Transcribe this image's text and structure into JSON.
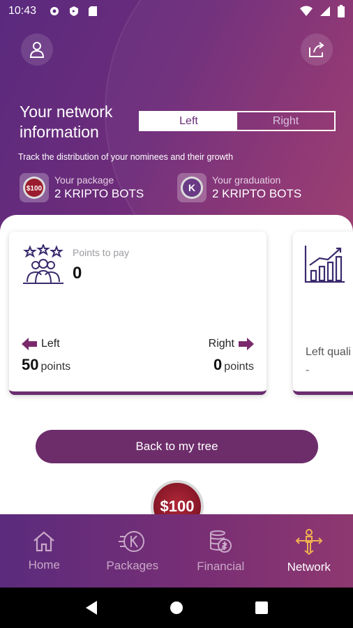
{
  "status": {
    "time": "10:43"
  },
  "header": {
    "title": "Your network information",
    "segment": {
      "left": "Left",
      "right": "Right",
      "selected": "Left"
    },
    "subtitle": "Track the distribution of your nominees and their growth",
    "package": {
      "label": "Your package",
      "value": "2 KRIPTO BOTS",
      "badge": "$100"
    },
    "graduation": {
      "label": "Your graduation",
      "value": "2 KRIPTO BOTS",
      "badge": "K"
    }
  },
  "cards": {
    "points": {
      "label": "Points to pay",
      "value": "0",
      "left_label": "Left",
      "left_value": "50",
      "right_label": "Right",
      "right_value": "0",
      "unit": "points"
    },
    "qualification": {
      "label": "Left quali",
      "value": "-"
    }
  },
  "actions": {
    "back_label": "Back to my tree"
  },
  "coin": {
    "label": "$100"
  },
  "nav": {
    "items": [
      {
        "label": "Home",
        "icon": "home-icon"
      },
      {
        "label": "Packages",
        "icon": "packages-icon"
      },
      {
        "label": "Financial",
        "icon": "financial-icon"
      },
      {
        "label": "Network",
        "icon": "network-icon"
      }
    ],
    "active": "Network"
  },
  "colors": {
    "primary": "#6d2d6b",
    "accent": "#8a3272",
    "active_nav": "#f0b050"
  }
}
